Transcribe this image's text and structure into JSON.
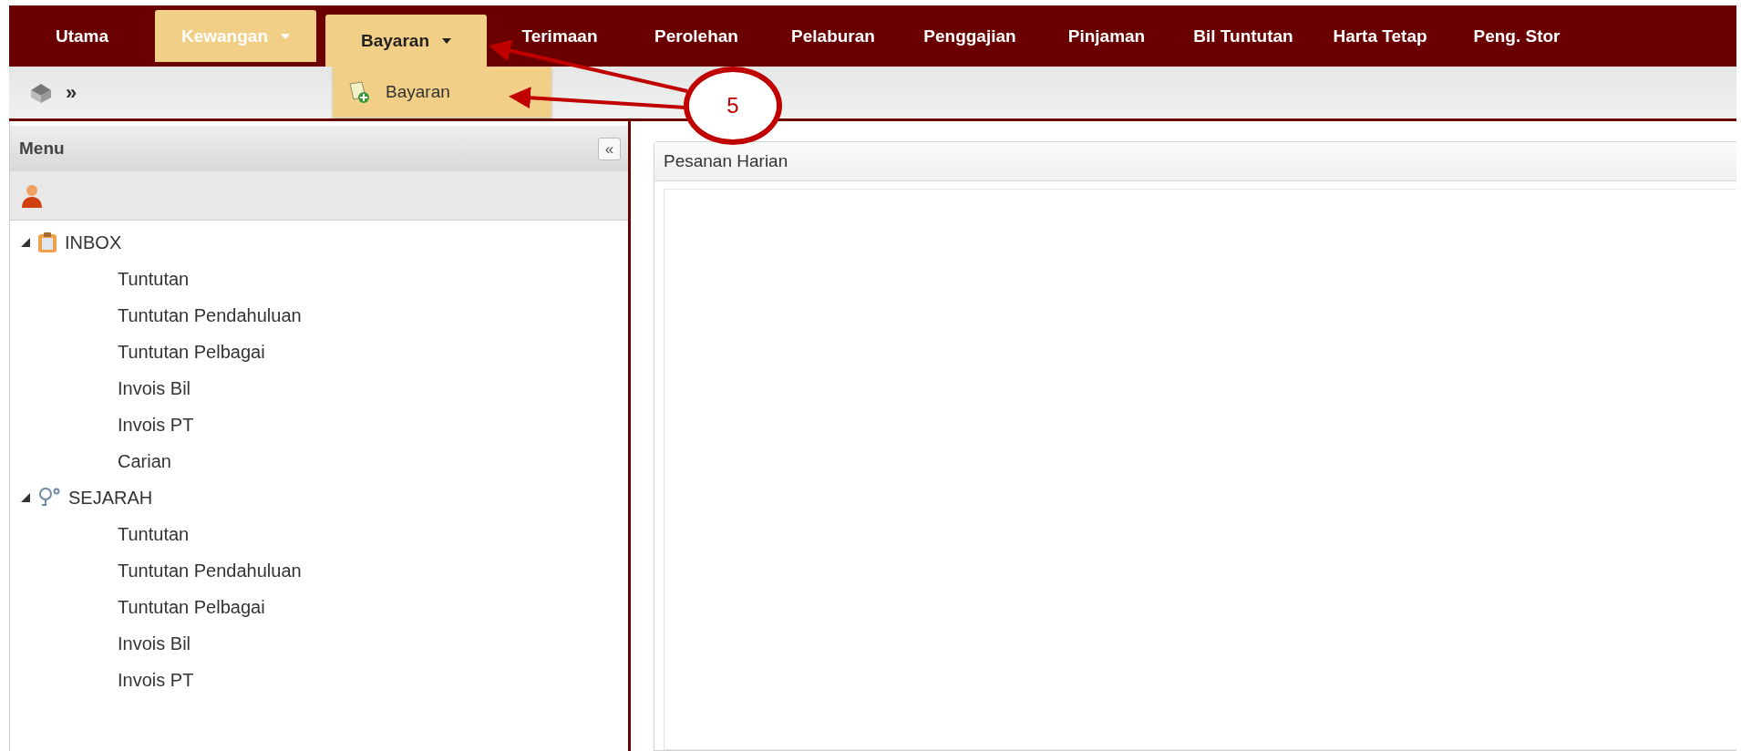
{
  "nav": {
    "items": [
      {
        "label": "Utama",
        "selected": false,
        "has_dropdown": false,
        "open": false
      },
      {
        "label": "Kewangan",
        "selected": true,
        "has_dropdown": true,
        "open": false
      },
      {
        "label": "Bayaran",
        "selected": false,
        "has_dropdown": true,
        "open": true
      },
      {
        "label": "Terimaan",
        "selected": false,
        "has_dropdown": false,
        "open": false
      },
      {
        "label": "Perolehan",
        "selected": false,
        "has_dropdown": false,
        "open": false
      },
      {
        "label": "Pelaburan",
        "selected": false,
        "has_dropdown": false,
        "open": false
      },
      {
        "label": "Penggajian",
        "selected": false,
        "has_dropdown": false,
        "open": false
      },
      {
        "label": "Pinjaman",
        "selected": false,
        "has_dropdown": false,
        "open": false
      },
      {
        "label": "Bil Tuntutan",
        "selected": false,
        "has_dropdown": false,
        "open": false
      },
      {
        "label": "Harta Tetap",
        "selected": false,
        "has_dropdown": false,
        "open": false
      },
      {
        "label": "Peng. Stor",
        "selected": false,
        "has_dropdown": false,
        "open": false
      }
    ]
  },
  "dropdown": {
    "items": [
      {
        "label": "Bayaran"
      }
    ]
  },
  "breadcrumb": {
    "separator": "»"
  },
  "sidebar": {
    "title": "Menu",
    "collapse": "«",
    "tree": [
      {
        "label": "INBOX",
        "kind": "inbox",
        "expanded": true,
        "children": [
          {
            "label": "Tuntutan"
          },
          {
            "label": "Tuntutan Pendahuluan"
          },
          {
            "label": "Tuntutan Pelbagai"
          },
          {
            "label": "Invois Bil"
          },
          {
            "label": "Invois PT"
          },
          {
            "label": "Carian"
          }
        ]
      },
      {
        "label": "SEJARAH",
        "kind": "history",
        "expanded": true,
        "children": [
          {
            "label": "Tuntutan"
          },
          {
            "label": "Tuntutan Pendahuluan"
          },
          {
            "label": "Tuntutan Pelbagai"
          },
          {
            "label": "Invois Bil"
          },
          {
            "label": "Invois PT"
          }
        ]
      }
    ]
  },
  "panel": {
    "title": "Pesanan Harian"
  },
  "callout": {
    "number": "5"
  }
}
